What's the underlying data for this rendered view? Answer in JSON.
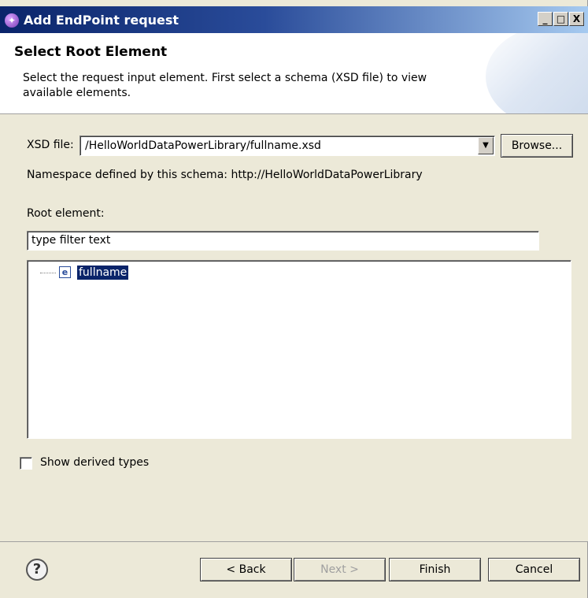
{
  "window": {
    "title": "Add EndPoint request",
    "minimize": "_",
    "maximize": "□",
    "close": "X"
  },
  "header": {
    "title": "Select Root Element",
    "description": "Select the request input element. First select a schema (XSD file) to view available elements."
  },
  "xsd": {
    "label": "XSD file:",
    "value": "/HelloWorldDataPowerLibrary/fullname.xsd",
    "browse_label": "Browse...",
    "namespace_text": "Namespace defined by this schema: http://HelloWorldDataPowerLibrary"
  },
  "root_element": {
    "label": "Root element:",
    "filter_value": "type filter text",
    "tree_items": [
      {
        "icon": "e",
        "label": "fullname",
        "selected": true
      }
    ]
  },
  "show_derived": {
    "label": "Show derived types",
    "checked": false
  },
  "footer": {
    "help": "?",
    "back_label": "< Back",
    "next_label": "Next >",
    "finish_label": "Finish",
    "cancel_label": "Cancel"
  }
}
